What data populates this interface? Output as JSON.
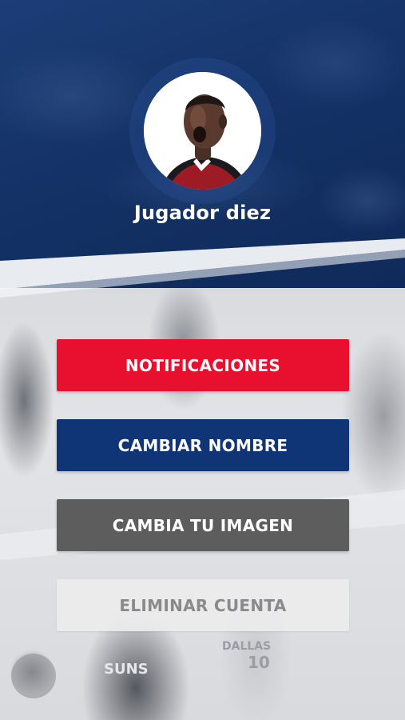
{
  "profile": {
    "name": "Jugador diez",
    "avatar_icon": "player-avatar"
  },
  "actions": {
    "notifications_label": "NOTIFICACIONES",
    "change_name_label": "CAMBIAR NOMBRE",
    "change_image_label": "CAMBIA TU IMAGEN",
    "delete_account_label": "ELIMINAR CUENTA"
  },
  "background": {
    "jersey_texts": [
      "SUNS",
      "DALLAS",
      "10"
    ]
  },
  "colors": {
    "header_blue": "#143266",
    "notifications": "#e8102e",
    "change_name": "#0f3577",
    "change_image": "#5d5d5d",
    "delete_account": "#ebebed"
  }
}
